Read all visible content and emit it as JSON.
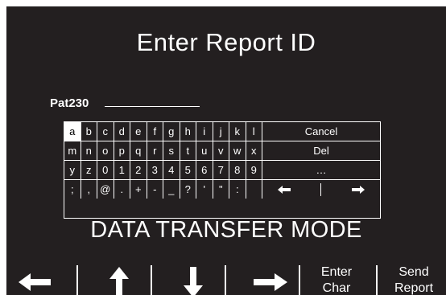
{
  "screen": {
    "title": "Enter Report ID",
    "entry_value": "Pat230",
    "mode_text": "DATA TRANSFER MODE"
  },
  "keyboard": {
    "selected_key": "a",
    "rows": [
      [
        "a",
        "b",
        "c",
        "d",
        "e",
        "f",
        "g",
        "h",
        "i",
        "j",
        "k",
        "l",
        "Cancel"
      ],
      [
        "m",
        "n",
        "o",
        "p",
        "q",
        "r",
        "s",
        "t",
        "u",
        "v",
        "w",
        "x",
        "Del"
      ],
      [
        "y",
        "z",
        "0",
        "1",
        "2",
        "3",
        "4",
        "5",
        "6",
        "7",
        "8",
        "9",
        "…"
      ],
      [
        ";",
        ",",
        "@",
        ".",
        "+",
        "-",
        "_",
        "?",
        "'",
        "\"",
        ":",
        "",
        ""
      ]
    ],
    "cursor_keys": [
      "left-arrow-icon",
      "right-arrow-icon"
    ]
  },
  "softkeys": [
    {
      "icon": "left-arrow-icon"
    },
    {
      "icon": "up-arrow-icon"
    },
    {
      "icon": "down-arrow-icon"
    },
    {
      "icon": "right-arrow-icon"
    },
    {
      "line1": "Enter",
      "line2": "Char"
    },
    {
      "line1": "Send",
      "line2": "Report"
    }
  ],
  "colors": {
    "screen_background": "#231f20",
    "foreground": "#ffffff",
    "selected_key_background": "#ffffff"
  }
}
